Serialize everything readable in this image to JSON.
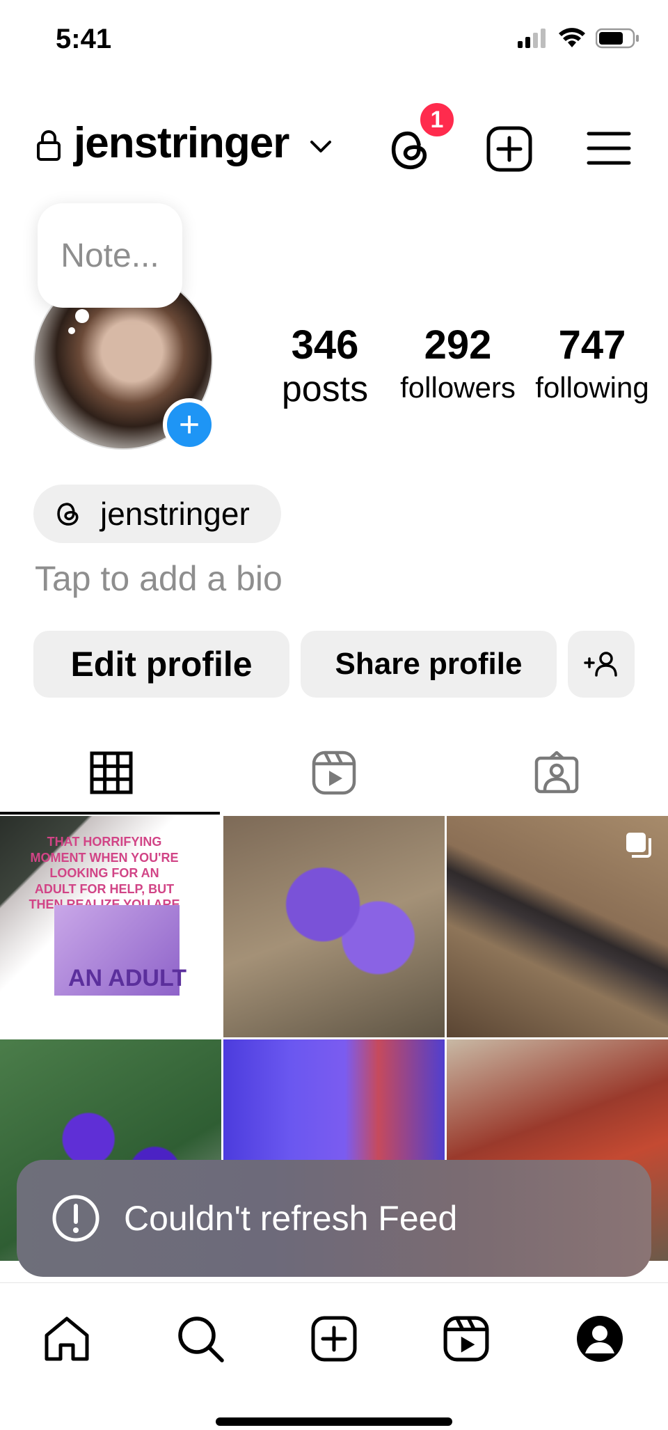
{
  "status_bar": {
    "time": "5:41",
    "icons": [
      "cellular-signal-icon",
      "wifi-icon",
      "battery-icon"
    ]
  },
  "header": {
    "username": "jenstringer",
    "threads_notification_count": "1",
    "icons": [
      "lock-icon",
      "chevron-down-icon",
      "threads-icon",
      "create-plus-icon",
      "menu-icon"
    ]
  },
  "note": {
    "placeholder": "Note..."
  },
  "profile": {
    "add_story_symbol": "+",
    "stats": {
      "posts_count": "346",
      "posts_label": "posts",
      "followers_count": "292",
      "followers_label": "followers",
      "following_count": "747",
      "following_label": "following"
    },
    "threads_handle": "jenstringer",
    "bio_placeholder": "Tap to add a bio"
  },
  "actions": {
    "edit_profile": "Edit profile",
    "share_profile": "Share profile"
  },
  "tabs": [
    {
      "name": "posts-grid",
      "icon": "grid-icon",
      "active": true
    },
    {
      "name": "reels",
      "icon": "reels-icon",
      "active": false
    },
    {
      "name": "tagged",
      "icon": "tagged-person-icon",
      "active": false
    }
  ],
  "grid_posts": [
    {
      "description": "mug",
      "mug_text": "THAT HORRIFYING MOMENT WHEN YOU'RE LOOKING FOR AN ADULT FOR HELP, BUT THEN REALIZE YOU ARE",
      "mug_caption": "AN ADULT"
    },
    {
      "description": "purple crocus"
    },
    {
      "description": "salamander",
      "multiple": true
    },
    {
      "description": "african violets"
    },
    {
      "description": "blue abstract"
    },
    {
      "description": "tubes in rack"
    }
  ],
  "toast": {
    "message": "Couldn't refresh Feed",
    "icon": "alert-circle-icon"
  },
  "bottom_nav": [
    "home-icon",
    "search-icon",
    "create-icon",
    "reels-icon",
    "profile-icon"
  ],
  "colors": {
    "badge_red": "#ff2b4d",
    "story_blue": "#1e95f5",
    "button_gray": "#efefef",
    "muted_text": "#8e8e8e"
  }
}
